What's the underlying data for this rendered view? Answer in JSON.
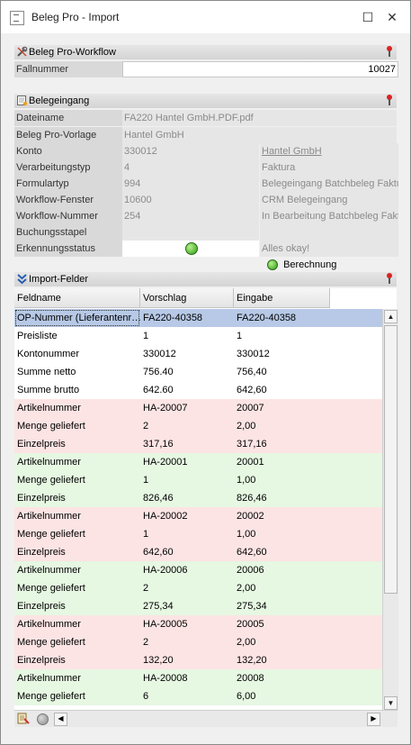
{
  "window": {
    "title": "Beleg Pro - Import"
  },
  "workflow": {
    "title": "Beleg Pro-Workflow",
    "fallnummer_label": "Fallnummer",
    "fallnummer_value": "10027"
  },
  "belegeingang": {
    "title": "Belegeingang",
    "rows": [
      {
        "label": "Dateiname",
        "value": "FA220 Hantel GmbH.PDF.pdf",
        "value2": ""
      },
      {
        "label": "Beleg Pro-Vorlage",
        "value": "Hantel GmbH",
        "value2": ""
      },
      {
        "label": "Konto",
        "value": "330012",
        "value2": "Hantel GmbH"
      },
      {
        "label": "Verarbeitungstyp",
        "value": "4",
        "value2": "Faktura"
      },
      {
        "label": "Formulartyp",
        "value": "994",
        "value2": "Belegeingang Batchbeleg Faktura"
      },
      {
        "label": "Workflow-Fenster",
        "value": "10600",
        "value2": "CRM Belegeingang"
      },
      {
        "label": "Workflow-Nummer",
        "value": "254",
        "value2": "In Bearbeitung Batchbeleg Faktura"
      },
      {
        "label": "Buchungsstapel",
        "value": "",
        "value2": ""
      },
      {
        "label": "Erkennungsstatus",
        "value": "",
        "value2": "Alles okay!"
      }
    ],
    "berechnung_label": "Berechnung"
  },
  "import_felder": {
    "title": "Import-Felder",
    "columns": [
      "Feldname",
      "Vorschlag",
      "Eingabe"
    ],
    "rows": [
      {
        "feld": "OP-Nummer (Lieferantenr…",
        "vorschlag": "FA220-40358",
        "eingabe": "FA220-40358",
        "color": "#b7c9e6"
      },
      {
        "feld": "Preisliste",
        "vorschlag": "1",
        "eingabe": "1",
        "color": "#ffffff"
      },
      {
        "feld": "Kontonummer",
        "vorschlag": "330012",
        "eingabe": "330012",
        "color": "#ffffff"
      },
      {
        "feld": "Summe netto",
        "vorschlag": "756.40",
        "eingabe": "756,40",
        "color": "#ffffff"
      },
      {
        "feld": "Summe brutto",
        "vorschlag": "642.60",
        "eingabe": "642,60",
        "color": "#ffffff"
      },
      {
        "feld": "Artikelnummer",
        "vorschlag": "HA-20007",
        "eingabe": "20007",
        "color": "#fce4e4"
      },
      {
        "feld": "Menge geliefert",
        "vorschlag": "2",
        "eingabe": "2,00",
        "color": "#fce4e4"
      },
      {
        "feld": "Einzelpreis",
        "vorschlag": "317,16",
        "eingabe": "317,16",
        "color": "#fce4e4"
      },
      {
        "feld": "Artikelnummer",
        "vorschlag": "HA-20001",
        "eingabe": "20001",
        "color": "#e6f7e2"
      },
      {
        "feld": "Menge geliefert",
        "vorschlag": "1",
        "eingabe": "1,00",
        "color": "#e6f7e2"
      },
      {
        "feld": "Einzelpreis",
        "vorschlag": "826,46",
        "eingabe": "826,46",
        "color": "#e6f7e2"
      },
      {
        "feld": "Artikelnummer",
        "vorschlag": "HA-20002",
        "eingabe": "20002",
        "color": "#fce4e4"
      },
      {
        "feld": "Menge geliefert",
        "vorschlag": "1",
        "eingabe": "1,00",
        "color": "#fce4e4"
      },
      {
        "feld": "Einzelpreis",
        "vorschlag": "642,60",
        "eingabe": "642,60",
        "color": "#fce4e4"
      },
      {
        "feld": "Artikelnummer",
        "vorschlag": "HA-20006",
        "eingabe": "20006",
        "color": "#e6f7e2"
      },
      {
        "feld": "Menge geliefert",
        "vorschlag": "2",
        "eingabe": "2,00",
        "color": "#e6f7e2"
      },
      {
        "feld": "Einzelpreis",
        "vorschlag": "275,34",
        "eingabe": "275,34",
        "color": "#e6f7e2"
      },
      {
        "feld": "Artikelnummer",
        "vorschlag": "HA-20005",
        "eingabe": "20005",
        "color": "#fce4e4"
      },
      {
        "feld": "Menge geliefert",
        "vorschlag": "2",
        "eingabe": "2,00",
        "color": "#fce4e4"
      },
      {
        "feld": "Einzelpreis",
        "vorschlag": "132,20",
        "eingabe": "132,20",
        "color": "#fce4e4"
      },
      {
        "feld": "Artikelnummer",
        "vorschlag": "HA-20008",
        "eingabe": "20008",
        "color": "#e6f7e2"
      },
      {
        "feld": "Menge geliefert",
        "vorschlag": "6",
        "eingabe": "6,00",
        "color": "#e6f7e2"
      }
    ]
  },
  "icons": {
    "workflow": "tools-icon",
    "belegeingang": "document-icon",
    "import": "double-chevron-down-icon",
    "pin": "pin-icon",
    "status": "green-led-icon"
  }
}
